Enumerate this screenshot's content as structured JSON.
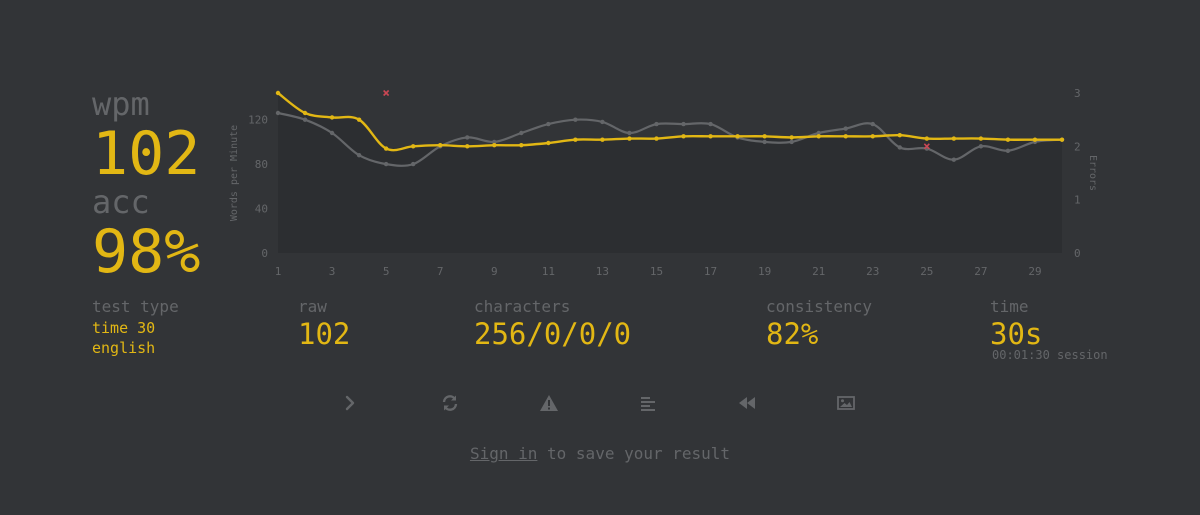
{
  "stats": {
    "wpm_label": "wpm",
    "wpm_value": "102",
    "acc_label": "acc",
    "acc_value": "98%"
  },
  "details": {
    "test_type_label": "test type",
    "test_type_mode": "time 30",
    "test_type_language": "english",
    "raw_label": "raw",
    "raw_value": "102",
    "characters_label": "characters",
    "characters_value": "256/0/0/0",
    "consistency_label": "consistency",
    "consistency_value": "82%",
    "time_label": "time",
    "time_value": "30s",
    "session_text": "00:01:30 session"
  },
  "actions": [
    {
      "name": "next-test-button",
      "icon": "chevron-right-icon"
    },
    {
      "name": "restart-test-button",
      "icon": "refresh-icon"
    },
    {
      "name": "report-button",
      "icon": "warning-icon"
    },
    {
      "name": "words-history-button",
      "icon": "align-left-icon"
    },
    {
      "name": "replay-button",
      "icon": "backward-icon"
    },
    {
      "name": "screenshot-button",
      "icon": "image-icon"
    }
  ],
  "footer": {
    "sign_in_label": "Sign in",
    "rest_text": " to save your result"
  },
  "colors": {
    "background": "#323437",
    "main": "#e2b714",
    "sub": "#646669",
    "raw_line": "#646669",
    "error_mark": "#ca4754",
    "chart_fill": "#2c2e31"
  },
  "chart_data": {
    "type": "line",
    "x": [
      1,
      2,
      3,
      4,
      5,
      6,
      7,
      8,
      9,
      10,
      11,
      12,
      13,
      14,
      15,
      16,
      17,
      18,
      19,
      20,
      21,
      22,
      23,
      24,
      25,
      26,
      27,
      28,
      29,
      30
    ],
    "x_tick_labels": [
      "1",
      "3",
      "5",
      "7",
      "9",
      "11",
      "13",
      "15",
      "17",
      "19",
      "21",
      "23",
      "25",
      "27",
      "29"
    ],
    "ylabel": "Words per Minute",
    "y2label": "Errors",
    "ylim": [
      0,
      144
    ],
    "y_ticks": [
      0,
      40,
      80,
      120
    ],
    "y2lim": [
      0,
      3
    ],
    "y2_ticks": [
      0,
      1,
      2,
      3
    ],
    "series": [
      {
        "values": [
          144,
          126,
          122,
          120,
          94,
          96,
          97,
          96,
          97,
          97,
          99,
          102,
          102,
          103,
          103,
          105,
          105,
          105,
          105,
          104,
          105,
          105,
          105,
          106,
          103,
          103,
          103,
          102,
          102,
          102
        ]
      },
      {
        "values": [
          126,
          120,
          108,
          88,
          80,
          80,
          96,
          104,
          100,
          108,
          116,
          120,
          118,
          108,
          116,
          116,
          116,
          104,
          100,
          100,
          108,
          112,
          116,
          95,
          94,
          84,
          96,
          92,
          100,
          102
        ]
      },
      {
        "type": "scatter",
        "x": [
          5,
          25
        ],
        "values": [
          3,
          2
        ]
      }
    ],
    "grid": false,
    "legend": "none"
  }
}
